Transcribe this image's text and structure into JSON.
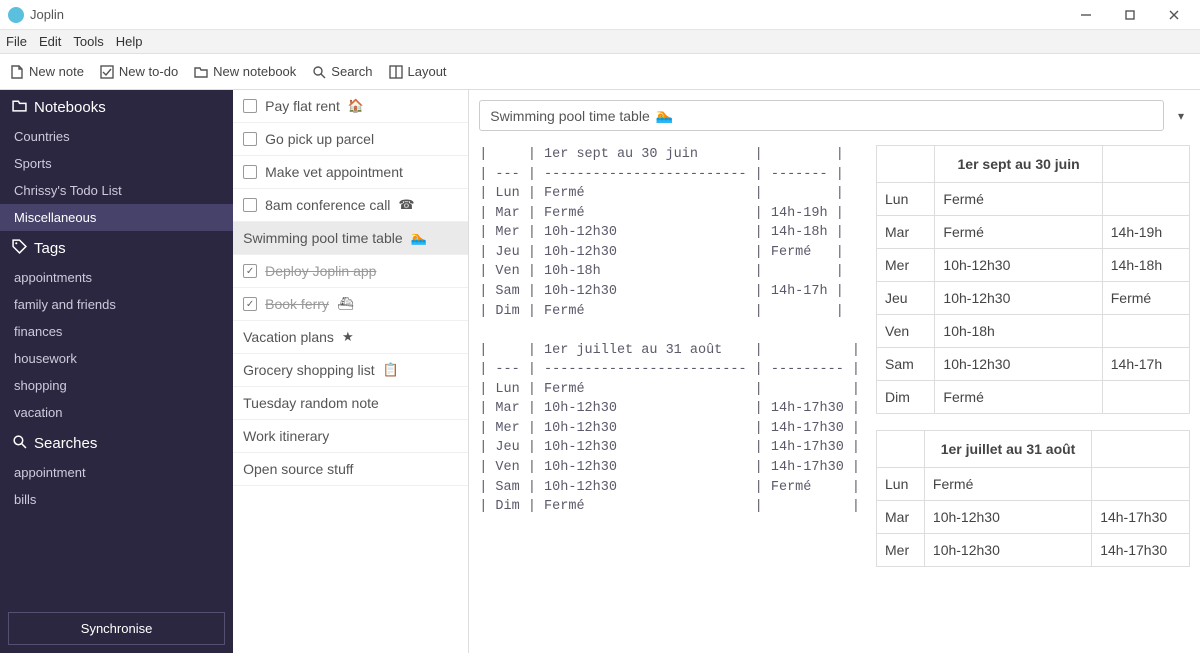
{
  "app": {
    "title": "Joplin"
  },
  "menubar": [
    "File",
    "Edit",
    "Tools",
    "Help"
  ],
  "toolbar": {
    "new_note": "New note",
    "new_todo": "New to-do",
    "new_notebook": "New notebook",
    "search": "Search",
    "layout": "Layout"
  },
  "sidebar": {
    "notebooks_hdr": "Notebooks",
    "notebooks": [
      "Countries",
      "Sports",
      "Chrissy's Todo List",
      "Miscellaneous"
    ],
    "notebooks_selected_index": 3,
    "tags_hdr": "Tags",
    "tags": [
      "appointments",
      "family and friends",
      "finances",
      "housework",
      "shopping",
      "vacation"
    ],
    "searches_hdr": "Searches",
    "searches": [
      "appointment",
      "bills"
    ],
    "sync_label": "Synchronise"
  },
  "notelist": [
    {
      "checkbox": true,
      "checked": false,
      "title": "Pay flat rent",
      "emoji": "🏠",
      "done": false
    },
    {
      "checkbox": true,
      "checked": false,
      "title": "Go pick up parcel",
      "emoji": "",
      "done": false
    },
    {
      "checkbox": true,
      "checked": false,
      "title": "Make vet appointment",
      "emoji": "",
      "done": false
    },
    {
      "checkbox": true,
      "checked": false,
      "title": "8am conference call",
      "emoji": "☎",
      "done": false
    },
    {
      "checkbox": false,
      "checked": false,
      "title": "Swimming pool time table",
      "emoji": "🏊",
      "done": false,
      "selected": true
    },
    {
      "checkbox": true,
      "checked": true,
      "title": "Deploy Joplin app",
      "emoji": "",
      "done": true
    },
    {
      "checkbox": true,
      "checked": true,
      "title": "Book ferry",
      "emoji": "⛴",
      "done": true
    },
    {
      "checkbox": false,
      "checked": false,
      "title": "Vacation plans",
      "emoji": "★",
      "done": false
    },
    {
      "checkbox": false,
      "checked": false,
      "title": "Grocery shopping list",
      "emoji": "📋",
      "done": false
    },
    {
      "checkbox": false,
      "checked": false,
      "title": "Tuesday random note",
      "emoji": "",
      "done": false
    },
    {
      "checkbox": false,
      "checked": false,
      "title": "Work itinerary",
      "emoji": "",
      "done": false
    },
    {
      "checkbox": false,
      "checked": false,
      "title": "Open source stuff",
      "emoji": "",
      "done": false
    }
  ],
  "editor": {
    "title": "Swimming pool time table",
    "title_emoji": "🏊",
    "raw_text": "|     | 1er sept au 30 juin       |         |\n| --- | ------------------------- | ------- |\n| Lun | Fermé                     |         |\n| Mar | Fermé                     | 14h-19h |\n| Mer | 10h-12h30                 | 14h-18h |\n| Jeu | 10h-12h30                 | Fermé   |\n| Ven | 10h-18h                   |         |\n| Sam | 10h-12h30                 | 14h-17h |\n| Dim | Fermé                     |         |\n\n|     | 1er juillet au 31 août    |           |\n| --- | ------------------------- | --------- |\n| Lun | Fermé                     |           |\n| Mar | 10h-12h30                 | 14h-17h30 |\n| Mer | 10h-12h30                 | 14h-17h30 |\n| Jeu | 10h-12h30                 | 14h-17h30 |\n| Ven | 10h-12h30                 | 14h-17h30 |\n| Sam | 10h-12h30                 | Fermé     |\n| Dim | Fermé                     |           |",
    "tables": [
      {
        "caption": "1er sept au 30 juin",
        "rows": [
          [
            "Lun",
            "Fermé",
            ""
          ],
          [
            "Mar",
            "Fermé",
            "14h-19h"
          ],
          [
            "Mer",
            "10h-12h30",
            "14h-18h"
          ],
          [
            "Jeu",
            "10h-12h30",
            "Fermé"
          ],
          [
            "Ven",
            "10h-18h",
            ""
          ],
          [
            "Sam",
            "10h-12h30",
            "14h-17h"
          ],
          [
            "Dim",
            "Fermé",
            ""
          ]
        ]
      },
      {
        "caption": "1er juillet au 31 août",
        "rows": [
          [
            "Lun",
            "Fermé",
            ""
          ],
          [
            "Mar",
            "10h-12h30",
            "14h-17h30"
          ],
          [
            "Mer",
            "10h-12h30",
            "14h-17h30"
          ]
        ]
      }
    ]
  }
}
